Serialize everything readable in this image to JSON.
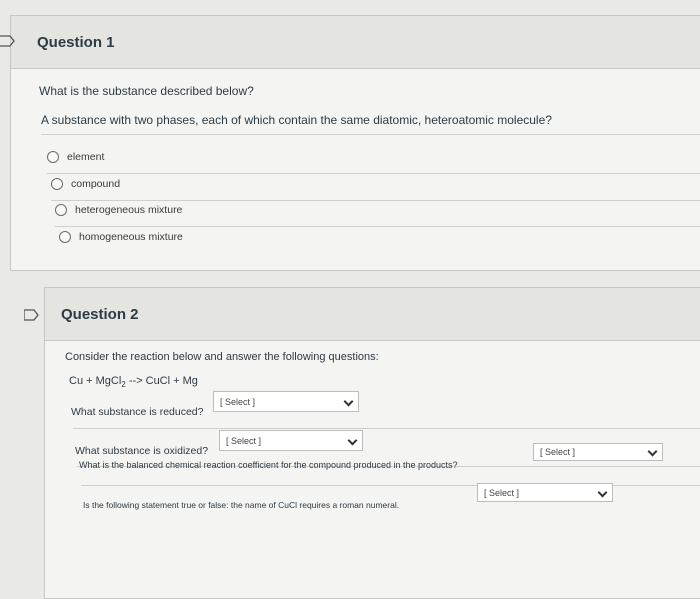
{
  "question1": {
    "title": "Question 1",
    "prompt": "What is the substance described below?",
    "description": "A substance with two phases, each of which contain the same diatomic, heteroatomic molecule?",
    "answers": [
      "element",
      "compound",
      "heterogeneous mixture",
      "homogeneous mixture"
    ]
  },
  "question2": {
    "title": "Question 2",
    "intro": "Consider the reaction below and answer the following questions:",
    "reaction": {
      "cu": "Cu",
      "plus1": "+",
      "mgcl": "MgCl",
      "sub2": "2",
      "arrow": "-->",
      "cucl": "CuCl",
      "plus2": "+",
      "mg": "Mg"
    },
    "items": [
      {
        "label": "What substance is reduced?",
        "select": "[ Select ]"
      },
      {
        "label": "What substance is oxidized?",
        "select": "[ Select ]"
      },
      {
        "label": "What is the balanced chemical reaction coefficient for the compound produced in the products?",
        "select": "[ Select ]"
      },
      {
        "label": "Is the following statement true or false: the name of CuCl requires a roman numeral.",
        "select": "[ Select ]"
      }
    ]
  }
}
